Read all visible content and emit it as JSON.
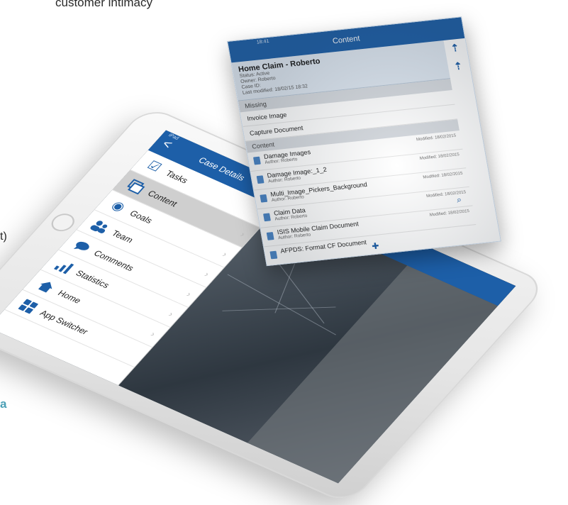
{
  "page": {
    "top_text": "customer intimacy",
    "left_paren": "t)",
    "left_accent": "a"
  },
  "sidebar": {
    "status": "iPad",
    "title": "Case Details",
    "back": "<",
    "items": [
      {
        "label": "Tasks",
        "icon": "checkbox-icon",
        "active": false
      },
      {
        "label": "Content",
        "icon": "content-icon",
        "active": true
      },
      {
        "label": "Goals",
        "icon": "target-icon",
        "active": false
      },
      {
        "label": "Team",
        "icon": "team-icon",
        "active": false
      },
      {
        "label": "Comments",
        "icon": "comment-icon",
        "active": false
      },
      {
        "label": "Statistics",
        "icon": "bar-chart-icon",
        "active": false
      },
      {
        "label": "Home",
        "icon": "home-icon",
        "active": false
      },
      {
        "label": "App Switcher",
        "icon": "grid-icon",
        "active": false
      }
    ]
  },
  "detail": {
    "back": "<"
  },
  "panel": {
    "title": "Content",
    "time": "18:41",
    "case": {
      "title": "Home Claim - Roberto",
      "status": "Status: Active",
      "owner": "Owner: Roberto",
      "case_id": "Case ID:",
      "last_modified": "Last modified: 18/02/15 18:32"
    },
    "missing_header": "Missing",
    "missing_items": [
      "Invoice Image",
      "Capture Document"
    ],
    "content_header": "Content",
    "documents": [
      {
        "name": "Damage Images",
        "author": "Author: Roberto",
        "modified": "Modified: 18/02/2015"
      },
      {
        "name": "Damage Image:_1_2",
        "author": "Author: Roberto",
        "modified": "Modified: 18/02/2015"
      },
      {
        "name": "Multi_Image_Pickers_Background",
        "author": "Author: Roberto",
        "modified": "Modified: 18/02/2015"
      },
      {
        "name": "Claim Data",
        "author": "Author: Roberto",
        "modified": "Modified: 18/02/2015"
      },
      {
        "name": "ISIS Mobile Claim Document",
        "author": "Author: Roberto",
        "modified": "Modified: 18/02/2015"
      },
      {
        "name": "AFPDS: Format CF Document",
        "author": "",
        "modified": ""
      }
    ]
  },
  "colors": {
    "nav_blue": "#1d5fa8",
    "accent_teal": "#4a9fb5"
  }
}
